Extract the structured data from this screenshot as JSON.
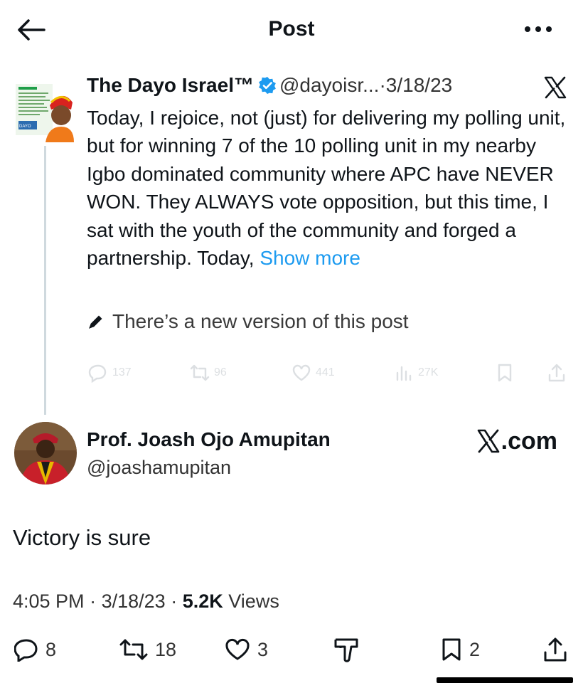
{
  "header": {
    "title": "Post"
  },
  "quoted_post": {
    "author_name": "The Dayo Israel™",
    "handle": "@dayoisr...",
    "separator": "·",
    "date": "3/18/23",
    "body": "Today, I rejoice, not (just) for delivering my polling unit, but for winning 7 of the 10 polling unit in my nearby Igbo dominated community where APC have NEVER WON. They ALWAYS vote opposition, but this time, I sat with the youth of the community and forged a partnership. Today, ",
    "show_more": "Show more",
    "edited_notice": "There’s a new version of this post",
    "faded_counts": {
      "replies": "137",
      "reposts": "96",
      "likes": "441",
      "views": "27K"
    },
    "avatar_lettering": "DAYO ISRAEL"
  },
  "reply_post": {
    "author_name": "Prof. Joash Ojo Amupitan",
    "handle": "@joashamupitan",
    "watermark": ".com",
    "text": "Victory is sure",
    "time": "4:05 PM",
    "date": "3/18/23",
    "separator": "·",
    "views_count": "5.2K",
    "views_label": "Views"
  },
  "actions": {
    "replies": "8",
    "reposts": "18",
    "likes": "3",
    "bookmarks": "2"
  },
  "colors": {
    "link": "#1d9bf0",
    "verified": "#1d9bf0",
    "muted_text": "#333333"
  },
  "icons": [
    "back-arrow-icon",
    "more-icon",
    "verified-badge-icon",
    "x-logo-icon",
    "pencil-icon",
    "reply-icon",
    "repost-icon",
    "like-icon",
    "views-icon",
    "bookmark-icon",
    "share-icon",
    "downvote-icon"
  ]
}
